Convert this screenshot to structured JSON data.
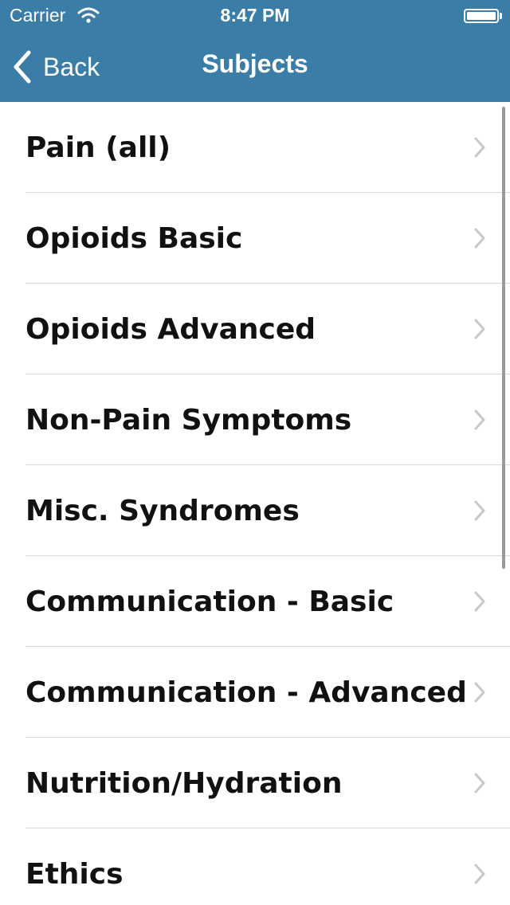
{
  "status_bar": {
    "carrier": "Carrier",
    "time": "8:47 PM",
    "wifi_icon": "wifi-icon",
    "battery_icon": "battery-icon"
  },
  "nav_bar": {
    "back_label": "Back",
    "title": "Subjects",
    "color": "#3a7ea8"
  },
  "subjects": [
    {
      "label": "Pain (all)"
    },
    {
      "label": "Opioids Basic"
    },
    {
      "label": "Opioids Advanced"
    },
    {
      "label": "Non-Pain Symptoms"
    },
    {
      "label": "Misc. Syndromes"
    },
    {
      "label": "Communication - Basic"
    },
    {
      "label": "Communication - Advanced"
    },
    {
      "label": "Nutrition/Hydration"
    },
    {
      "label": "Ethics"
    }
  ]
}
